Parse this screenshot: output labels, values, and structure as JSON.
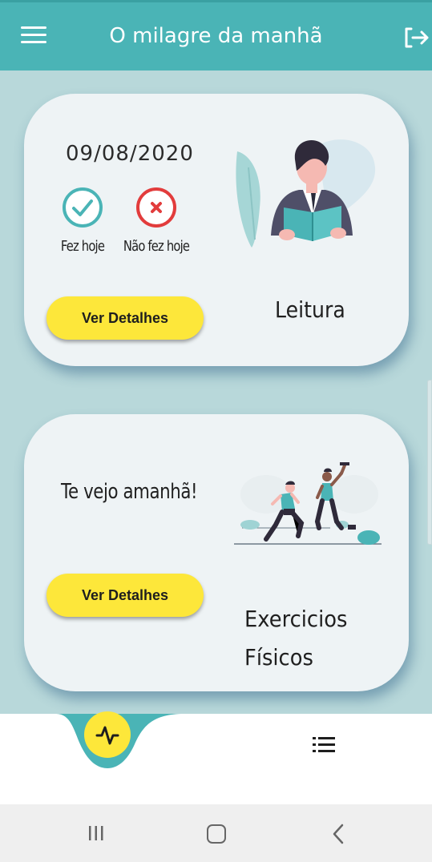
{
  "header": {
    "title": "O milagre da manhã",
    "menu_icon": "hamburger-menu-icon",
    "logout_icon": "logout-icon"
  },
  "cards": [
    {
      "date": "09/08/2020",
      "done_label": "Fez hoje",
      "not_done_label": "Não fez hoje",
      "button_label": "Ver Detalhes",
      "activity_title": "Leitura",
      "illustration": "person-reading-book"
    },
    {
      "message": "Te vejo amanhã!",
      "button_label": "Ver Detalhes",
      "activity_title_line1": "Exercicios",
      "activity_title_line2": "Físicos",
      "illustration": "people-exercising"
    }
  ],
  "bottom_nav": {
    "items": [
      {
        "icon": "activity-pulse-icon",
        "active": true
      },
      {
        "icon": "list-icon",
        "active": false
      }
    ]
  },
  "colors": {
    "primary": "#4ab4b6",
    "background": "#b8d8da",
    "card": "#eef3f5",
    "accent_yellow": "#fde73a",
    "done_teal": "#4ab4b6",
    "not_done_red": "#e23c3c"
  },
  "system_nav": {
    "icons": [
      "recent-apps-icon",
      "home-icon",
      "back-icon"
    ]
  }
}
